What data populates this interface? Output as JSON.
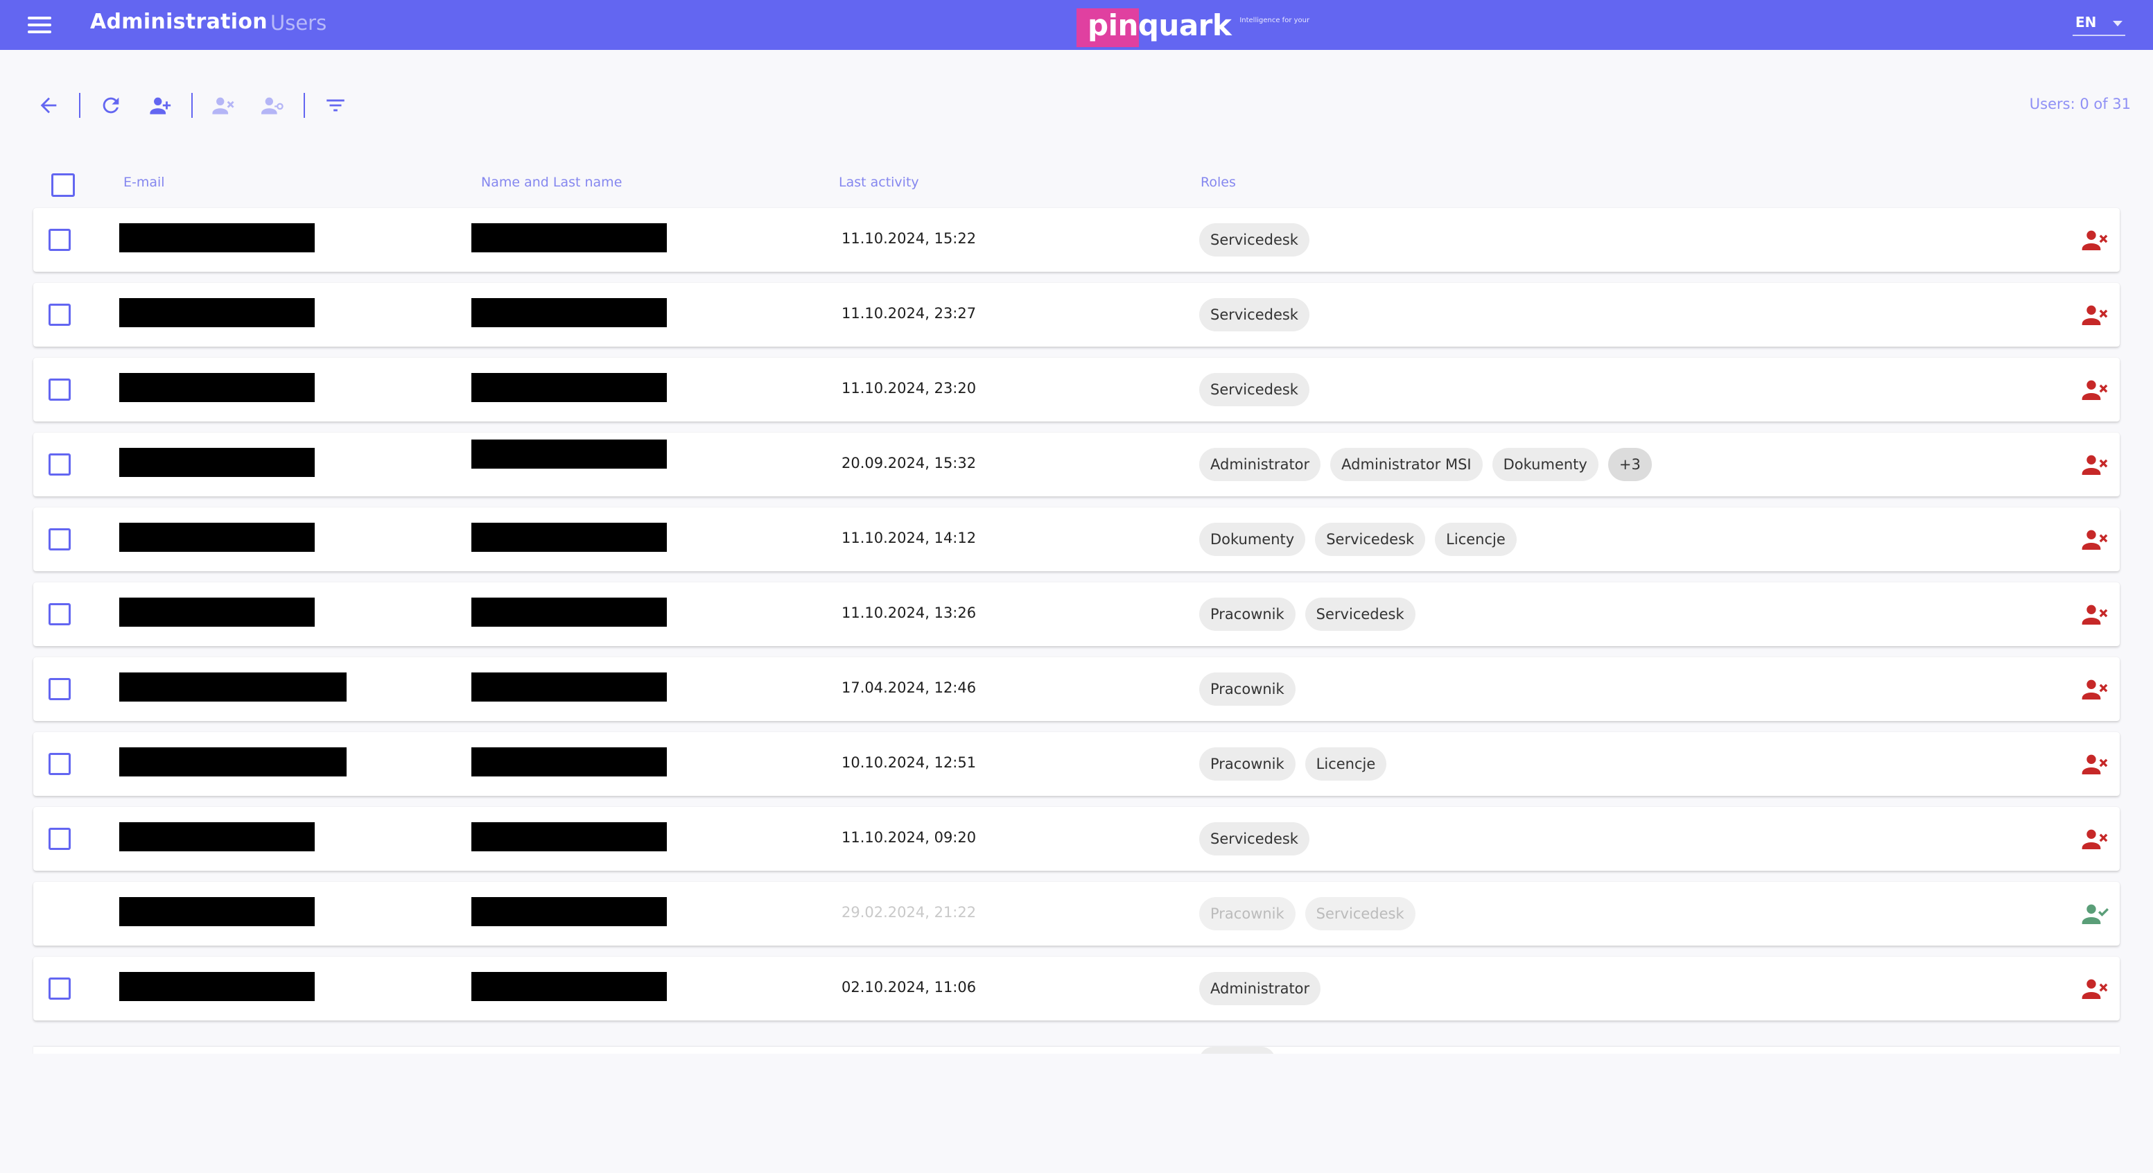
{
  "header": {
    "title": "Administration",
    "subtitle": "Users",
    "logo_text": "pinquark",
    "logo_tagline": "Intelligence for your",
    "language": "EN"
  },
  "toolbar": {
    "icons": [
      "back-arrow-icon",
      "refresh-icon",
      "add-user-icon",
      "remove-user-icon",
      "user-key-icon",
      "filter-icon"
    ],
    "users_count": "Users: 0 of 31"
  },
  "columns": {
    "email": "E-mail",
    "name": "Name and Last name",
    "activity": "Last activity",
    "roles": "Roles"
  },
  "colors": {
    "accent": "#6366f1",
    "danger": "#c62828",
    "success": "#5a9e78"
  },
  "rows": [
    {
      "activity": "11.10.2024, 15:22",
      "roles": [
        "Servicedesk"
      ],
      "disabled": false
    },
    {
      "activity": "11.10.2024, 23:27",
      "roles": [
        "Servicedesk"
      ],
      "disabled": false
    },
    {
      "activity": "11.10.2024, 23:20",
      "roles": [
        "Servicedesk"
      ],
      "disabled": false
    },
    {
      "activity": "20.09.2024, 15:32",
      "roles": [
        "Administrator",
        "Administrator MSI",
        "Dokumenty",
        "+3"
      ],
      "disabled": false
    },
    {
      "activity": "11.10.2024, 14:12",
      "roles": [
        "Dokumenty",
        "Servicedesk",
        "Licencje"
      ],
      "disabled": false
    },
    {
      "activity": "11.10.2024, 13:26",
      "roles": [
        "Pracownik",
        "Servicedesk"
      ],
      "disabled": false
    },
    {
      "activity": "17.04.2024, 12:46",
      "roles": [
        "Pracownik"
      ],
      "disabled": false
    },
    {
      "activity": "10.10.2024, 12:51",
      "roles": [
        "Pracownik",
        "Licencje"
      ],
      "disabled": false
    },
    {
      "activity": "11.10.2024, 09:20",
      "roles": [
        "Servicedesk"
      ],
      "disabled": false
    },
    {
      "activity": "29.02.2024, 21:22",
      "roles": [
        "Pracownik",
        "Servicedesk"
      ],
      "disabled": true
    },
    {
      "activity": "02.10.2024, 11:06",
      "roles": [
        "Administrator"
      ],
      "disabled": false
    }
  ]
}
